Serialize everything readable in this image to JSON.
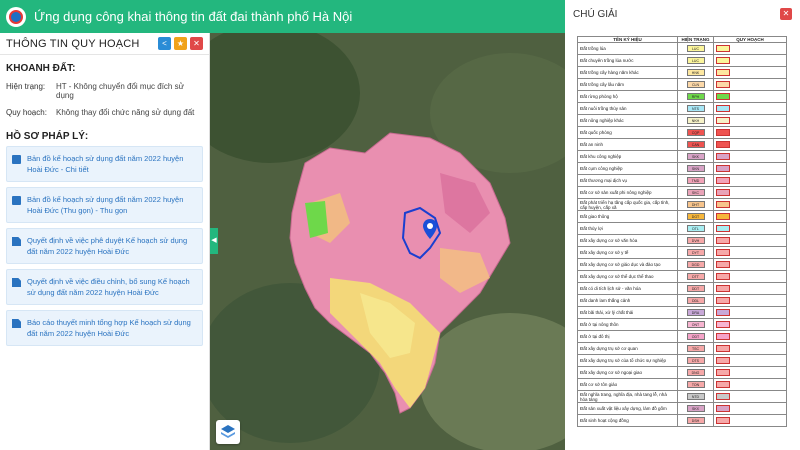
{
  "header": {
    "title": "Ứng dụng công khai thông tin đất đai thành phố Hà Nội"
  },
  "left": {
    "panel_title": "THÔNG TIN QUY HOẠCH",
    "khoanh_dat_title": "KHOANH ĐẤT:",
    "hien_trang_label": "Hiện trạng:",
    "hien_trang_value": "HT - Không chuyển đổi mục đích sử dụng",
    "quy_hoach_label": "Quy hoạch:",
    "quy_hoach_value": "Không thay đổi chức năng sử dụng đất",
    "ho_so_title": "HỒ SƠ PHÁP LÝ:",
    "docs": [
      {
        "text": "Bản đồ kế hoạch sử dụng đất năm 2022 huyện Hoài Đức - Chi tiết"
      },
      {
        "text": "Bản đồ kế hoạch sử dụng đất năm 2022 huyện Hoài Đức (Thu gọn) - Thu gọn"
      },
      {
        "text": "Quyết định về việc phê duyệt Kế hoạch sử dụng đất năm 2022 huyện Hoài Đức"
      },
      {
        "text": "Quyết định về việc điều chỉnh, bổ sung Kế hoạch sử dụng đất năm 2022 huyện Hoài Đức"
      },
      {
        "text": "Báo cáo thuyết minh tổng hợp Kế hoạch sử dụng đất năm 2022 huyện Hoài Đức"
      }
    ]
  },
  "legend": {
    "title": "CHÚ GIẢI",
    "col_name": "TÊN KÝ HIỆU",
    "col_ht": "HIỆN TRẠNG",
    "col_qh": "QUY HOẠCH",
    "rows": [
      {
        "name": "Đất trồng lúa",
        "code": "LUC",
        "color": "#fbf59b"
      },
      {
        "name": "Đất chuyên trồng lúa nước",
        "code": "LUC",
        "color": "#fbf59b"
      },
      {
        "name": "Đất trồng cây hàng năm khác",
        "code": "HNK",
        "color": "#fde7a0"
      },
      {
        "name": "Đất trồng cây lâu năm",
        "code": "CLN",
        "color": "#fcd8a8"
      },
      {
        "name": "Đất rừng phòng hộ",
        "code": "RPH",
        "color": "#6ed84a"
      },
      {
        "name": "Đất nuôi trồng thủy sản",
        "code": "NTS",
        "color": "#a8e7f6"
      },
      {
        "name": "Đất nông nghiệp khác",
        "code": "NKH",
        "color": "#f6f2c8"
      },
      {
        "name": "Đất quốc phòng",
        "code": "CQP",
        "color": "#ef5350"
      },
      {
        "name": "Đất an ninh",
        "code": "CAN",
        "color": "#ef5350"
      },
      {
        "name": "Đất khu công nghiệp",
        "code": "SKK",
        "color": "#d8a3c6"
      },
      {
        "name": "Đất cụm công nghiệp",
        "code": "SKN",
        "color": "#d8a3c6"
      },
      {
        "name": "Đất thương mại dịch vụ",
        "code": "TMD",
        "color": "#f2a3b8"
      },
      {
        "name": "Đất cơ sở sản xuất phi nông nghiệp",
        "code": "SKC",
        "color": "#e9a3b8"
      },
      {
        "name": "Đất phát triển hạ tầng cấp quốc gia, cấp tỉnh, cấp huyện, cấp xã",
        "code": "DHT",
        "color": "#f7c48c"
      },
      {
        "name": "Đất giao thông",
        "code": "DGT",
        "color": "#f6b63b"
      },
      {
        "name": "Đất thủy lợi",
        "code": "DTL",
        "color": "#a8eef2"
      },
      {
        "name": "Đất xây dựng cơ sở văn hóa",
        "code": "DVH",
        "color": "#f6a8a8"
      },
      {
        "name": "Đất xây dựng cơ sở y tế",
        "code": "DYT",
        "color": "#f6a8a8"
      },
      {
        "name": "Đất xây dựng cơ sở giáo dục và đào tạo",
        "code": "DGD",
        "color": "#f6a8a8"
      },
      {
        "name": "Đất xây dựng cơ sở thể dục thể thao",
        "code": "DTT",
        "color": "#f6a8a8"
      },
      {
        "name": "Đất có di tích lịch sử - văn hóa",
        "code": "DDT",
        "color": "#f6a8a8"
      },
      {
        "name": "Đất danh lam thắng cảnh",
        "code": "DDL",
        "color": "#f6a8a8"
      },
      {
        "name": "Đất bãi thải, xử lý chất thải",
        "code": "DRA",
        "color": "#c8a8d8"
      },
      {
        "name": "Đất ở tại nông thôn",
        "code": "ONT",
        "color": "#f7b4d0"
      },
      {
        "name": "Đất ở tại đô thị",
        "code": "ODT",
        "color": "#f5a3c8"
      },
      {
        "name": "Đất xây dựng trụ sở cơ quan",
        "code": "TSC",
        "color": "#f6a8a8"
      },
      {
        "name": "Đất xây dựng trụ sở của tổ chức sự nghiệp",
        "code": "DTS",
        "color": "#f6a8a8"
      },
      {
        "name": "Đất xây dựng cơ sở ngoại giao",
        "code": "DNG",
        "color": "#f6a8a8"
      },
      {
        "name": "Đất cơ sở tôn giáo",
        "code": "TON",
        "color": "#f6a8a8"
      },
      {
        "name": "Đất nghĩa trang, nghĩa địa, nhà tang lễ, nhà hỏa táng",
        "code": "NTD",
        "color": "#c8c8c8"
      },
      {
        "name": "Đất sản xuất vật liệu xây dựng, làm đồ gốm",
        "code": "SKX",
        "color": "#d8a3c6"
      },
      {
        "name": "Đất sinh hoạt cộng đồng",
        "code": "DSH",
        "color": "#f6a8a8"
      }
    ]
  }
}
